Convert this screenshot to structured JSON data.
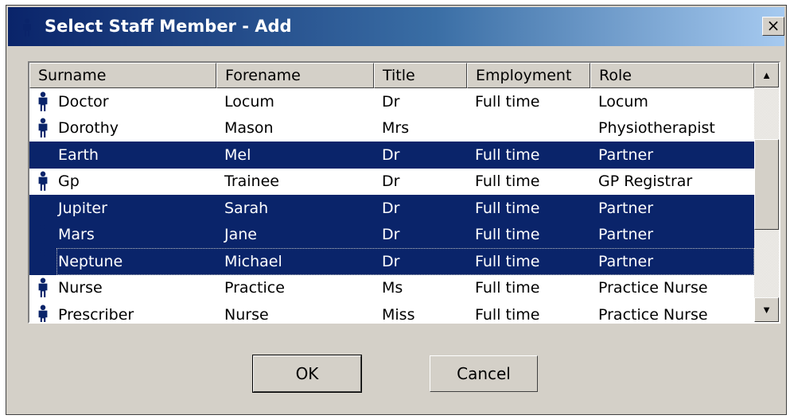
{
  "window": {
    "title": "Select Staff Member - Add",
    "title_icon": "staff-person-icon",
    "close_label": "×"
  },
  "list": {
    "columns": [
      "Surname",
      "Forename",
      "Title",
      "Employment",
      "Role"
    ],
    "rows": [
      {
        "surname": "Doctor",
        "forename": "Locum",
        "title": "Dr",
        "employment": "Full time",
        "role": "Locum",
        "selected": false
      },
      {
        "surname": "Dorothy",
        "forename": "Mason",
        "title": "Mrs",
        "employment": "",
        "role": "Physiotherapist",
        "selected": false
      },
      {
        "surname": "Earth",
        "forename": "Mel",
        "title": "Dr",
        "employment": "Full time",
        "role": "Partner",
        "selected": true
      },
      {
        "surname": "Gp",
        "forename": "Trainee",
        "title": "Dr",
        "employment": "Full time",
        "role": "GP Registrar",
        "selected": false
      },
      {
        "surname": "Jupiter",
        "forename": "Sarah",
        "title": "Dr",
        "employment": "Full time",
        "role": "Partner",
        "selected": true
      },
      {
        "surname": "Mars",
        "forename": "Jane",
        "title": "Dr",
        "employment": "Full time",
        "role": "Partner",
        "selected": true
      },
      {
        "surname": "Neptune",
        "forename": "Michael",
        "title": "Dr",
        "employment": "Full time",
        "role": "Partner",
        "selected": true,
        "focused": true
      },
      {
        "surname": "Nurse",
        "forename": "Practice",
        "title": "Ms",
        "employment": "Full time",
        "role": "Practice Nurse",
        "selected": false
      },
      {
        "surname": "Prescriber",
        "forename": "Nurse",
        "title": "Miss",
        "employment": "Full time",
        "role": "Practice Nurse",
        "selected": false
      }
    ],
    "row_icon": "staff-person-icon",
    "scroll_up_icon": "▲",
    "scroll_down_icon": "▼"
  },
  "buttons": {
    "ok_label": "OK",
    "cancel_label": "Cancel"
  },
  "colors": {
    "selection": "#0a246a",
    "icon": "#0a246a",
    "dialog_face": "#d4d0c8"
  }
}
